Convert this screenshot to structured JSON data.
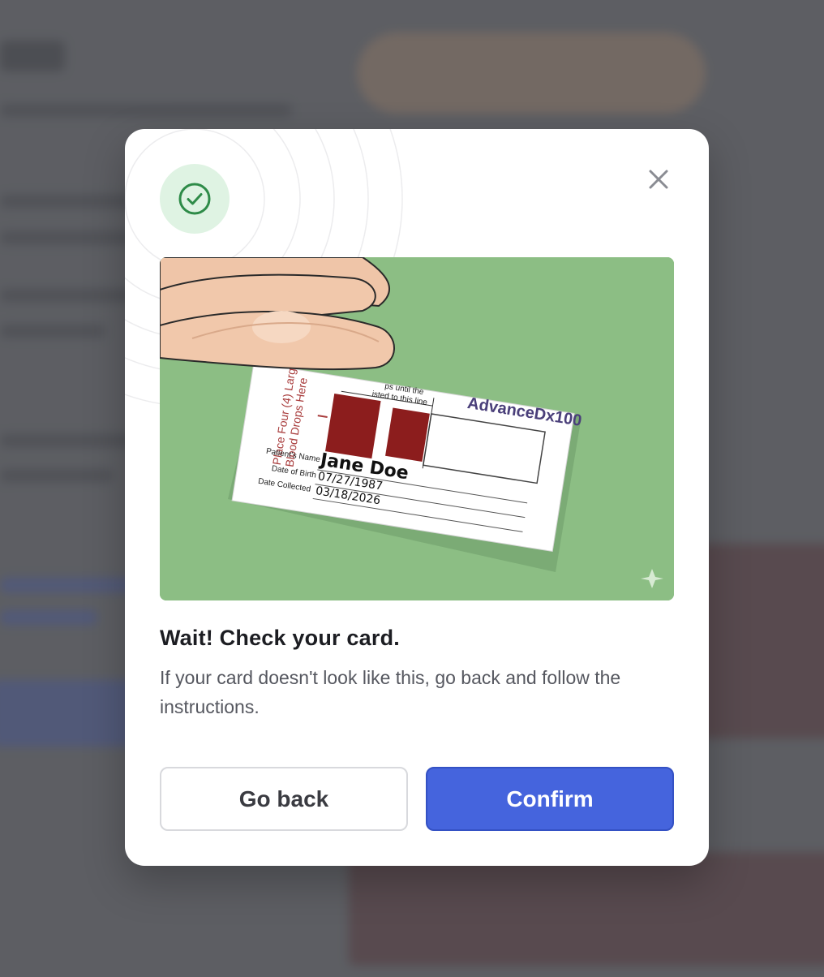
{
  "modal": {
    "status_icon": "check-circle-icon",
    "close_icon": "close-icon",
    "title": "Wait! Check your card.",
    "description": "If your card doesn't look like this, go back and follow the instructions.",
    "back_label": "Go back",
    "confirm_label": "Confirm"
  },
  "card": {
    "instruction_line1": "Place Four (4) Large",
    "instruction_line2": "Blood Drops Here",
    "fill_note_line1": "ps until the",
    "fill_note_line2": "isted to this line",
    "brand": "AdvanceDx100",
    "patient_name_label": "Patient's Name",
    "patient_name": "Jane Doe",
    "dob_label": "Date of Birth",
    "dob": "07/27/1987",
    "collected_label": "Date Collected",
    "collected": "03/18/2026"
  },
  "colors": {
    "accent": "#4564dd",
    "success_bg": "#dff3e3",
    "success": "#2e8b48",
    "illustration_bg": "#8cbe84",
    "blood": "#8c1d1d"
  }
}
